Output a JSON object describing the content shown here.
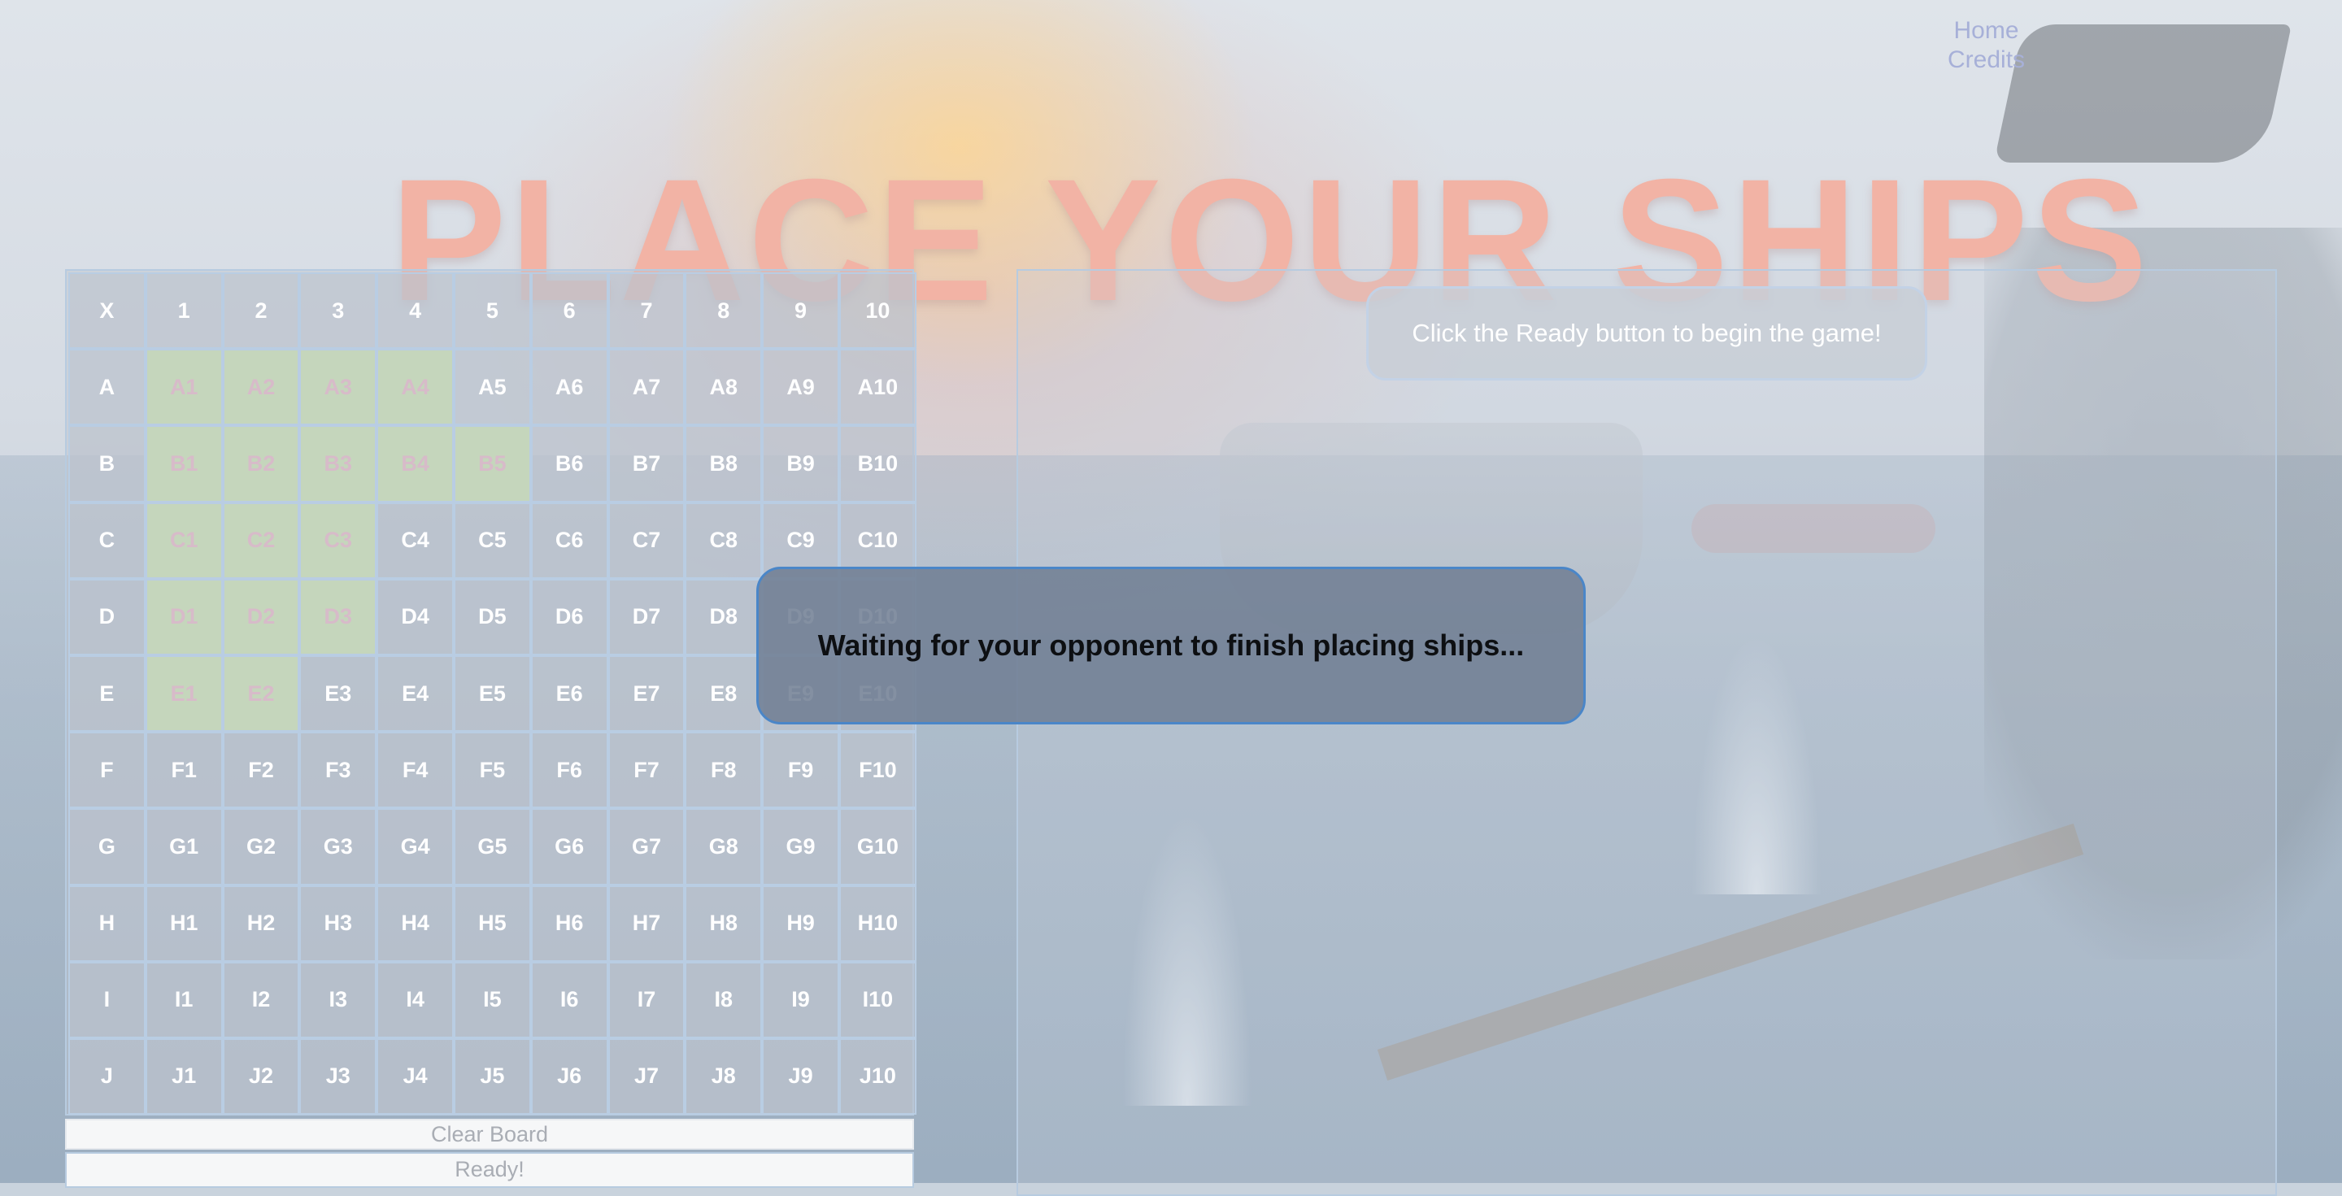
{
  "header": {
    "title": "PLACE YOUR SHIPS"
  },
  "nav": {
    "home": "Home",
    "credits": "Credits"
  },
  "board": {
    "corner": "X",
    "columns": [
      "1",
      "2",
      "3",
      "4",
      "5",
      "6",
      "7",
      "8",
      "9",
      "10"
    ],
    "rows": [
      "A",
      "B",
      "C",
      "D",
      "E",
      "F",
      "G",
      "H",
      "I",
      "J"
    ],
    "ship_cells": [
      "A1",
      "A2",
      "A3",
      "A4",
      "B1",
      "B2",
      "B3",
      "B4",
      "B5",
      "C1",
      "C2",
      "C3",
      "D1",
      "D2",
      "D3",
      "E1",
      "E2"
    ],
    "ship_color": "#c5d6bc"
  },
  "controls": {
    "clear_label": "Clear Board",
    "ready_label": "Ready!"
  },
  "opponent": {
    "hint": "Click the Ready button to begin the game!"
  },
  "modal": {
    "message": "Waiting for your opponent to finish placing ships..."
  },
  "colors": {
    "title": "#f2b3a5",
    "modal_border": "#4a86c8",
    "grid_line": "#b9cde3"
  }
}
